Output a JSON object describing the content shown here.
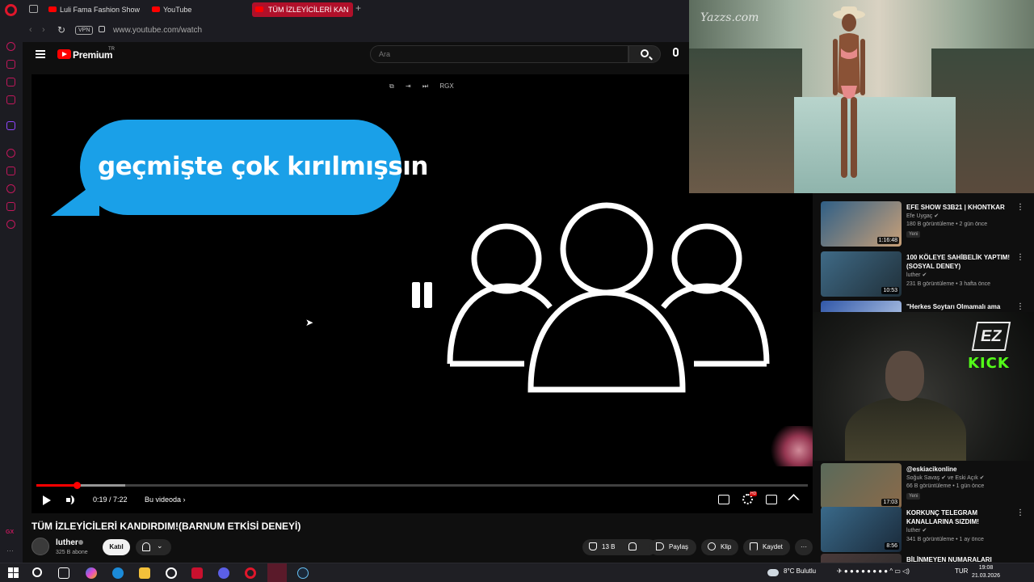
{
  "browser": {
    "tabs": [
      {
        "label": "Luli Fama Fashion Show S",
        "active": false
      },
      {
        "label": "YouTube",
        "active": false
      },
      {
        "label": "TÜM İZLEYİCİLERİ KAN",
        "active": true
      }
    ],
    "new_tab": "+",
    "vpn_label": "VPN",
    "url": "www.youtube.com/watch",
    "sidebar_gx": "GX",
    "sidebar_more": "···"
  },
  "youtube_header": {
    "brand": "Premium",
    "country": "TR",
    "search_placeholder": "Ara"
  },
  "player": {
    "bubble_text": "geçmişte çok kırılmışsın",
    "mini_toolbar": [
      "⧉",
      "⇥",
      "⏭",
      "RGX"
    ],
    "time": "0:19 / 7:22",
    "chapter": "Bu videoda ›",
    "progress_fraction": 0.052,
    "buffer_fraction": 0.115,
    "hd_badge": "HD"
  },
  "video_info": {
    "title": "TÜM İZLEYİCİLERİ KANDIRDIM!(BARNUM ETKİSİ DENEYİ)",
    "channel": "luther",
    "subscribers": "325 B abone",
    "join_label": "Katıl",
    "bell_chevron": "⌄",
    "likes": "13 B",
    "share_label": "Paylaş",
    "clip_label": "Klip",
    "save_label": "Kaydet",
    "more_label": "···"
  },
  "overlay": {
    "watermark": "Yazzs.com"
  },
  "recommendations_upper": [
    {
      "title": "EFE SHOW S3B21 | KHONTKAR",
      "channel": "Efe Uygaç ✔",
      "meta": "180 B görüntüleme • 2 gün önce",
      "badge": "Yeni",
      "duration": "1:16:48",
      "thumb_color": "#2f5f86"
    },
    {
      "title": "100 KÖLEYE SAHİBELİK YAPTIM! (SOSYAL DENEY)",
      "channel": "luther ✔",
      "meta": "231 B görüntüleme • 3 hafta önce",
      "badge": "",
      "duration": "10:53",
      "thumb_color": "#3f6a86"
    },
    {
      "title": "\"Herkes Soytarı Olmamalı ama",
      "channel": "",
      "meta": "",
      "badge": "",
      "duration": "",
      "thumb_color": "#3057a8"
    }
  ],
  "webcam": {
    "ez_label": "EZ",
    "kick_label": "KICK"
  },
  "recommendations_lower": [
    {
      "title": "@eskiacikonline",
      "channel": "Soğuk Savaş ✔ ve Eski Açık ✔",
      "meta": "66 B görüntüleme • 1 gün önce",
      "badge": "Yeni",
      "duration": "17:03",
      "thumb_color": "#5a6a5a"
    },
    {
      "title": "KORKUNÇ TELEGRAM KANALLARINA SIZDIM!",
      "channel": "luther ✔",
      "meta": "341 B görüntüleme • 1 ay önce",
      "badge": "",
      "duration": "8:56",
      "thumb_color": "#3a6a8a"
    },
    {
      "title": "BİLİNMEYEN NUMARALARI",
      "channel": "",
      "meta": "",
      "badge": "",
      "duration": "",
      "thumb_color": "#4a3a3a"
    }
  ],
  "taskbar": {
    "weather": "8°C  Bulutlu",
    "language": "TUR",
    "time": "19:08",
    "date": "21.03.2026"
  }
}
